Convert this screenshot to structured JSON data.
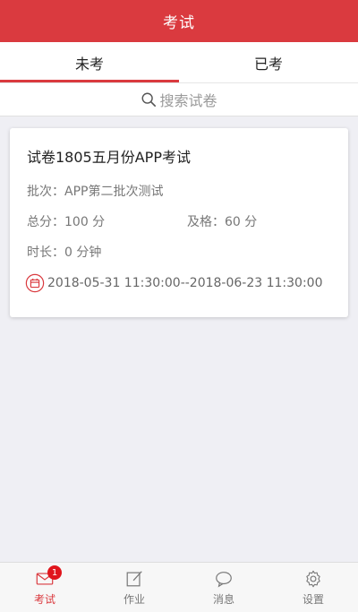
{
  "header": {
    "title": "考试"
  },
  "tabs": [
    {
      "label": "未考",
      "active": true
    },
    {
      "label": "已考",
      "active": false
    }
  ],
  "search": {
    "placeholder": "搜索试卷",
    "icon": "search-icon"
  },
  "exam_card": {
    "title": "试卷1805五月份APP考试",
    "batch": "批次：APP第二批次测试",
    "total_score": "总分：100 分",
    "pass_score": "及格：60 分",
    "duration": "时长：0 分钟",
    "date_range": "2018-05-31 11:30:00--2018-06-23 11:30:00",
    "date_icon": "calendar-icon"
  },
  "bottom_nav": [
    {
      "label": "考试",
      "icon": "mail-icon",
      "badge": "1",
      "active": true
    },
    {
      "label": "作业",
      "icon": "edit-icon",
      "active": false
    },
    {
      "label": "消息",
      "icon": "chat-icon",
      "active": false
    },
    {
      "label": "设置",
      "icon": "gear-icon",
      "active": false
    }
  ],
  "colors": {
    "accent": "#da3a3f",
    "badge": "#e0151c"
  }
}
